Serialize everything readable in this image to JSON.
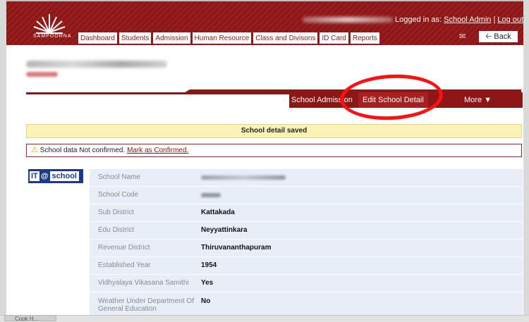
{
  "app": {
    "logo_text": "SAMPOORNA",
    "login_prefix": "Logged in as:",
    "user_role": "School Admin",
    "separator": "|",
    "logout": "Log out",
    "back": "Back",
    "mail_icon": "envelope-icon",
    "back_icon": "arrow-left-icon"
  },
  "nav": {
    "items": [
      "Dashboard",
      "Students",
      "Admission",
      "Human Resource",
      "Class and Divisons",
      "ID Card",
      "Reports"
    ]
  },
  "subnav": {
    "items": [
      "School Admission",
      "Edit School Detail",
      "More ▼"
    ]
  },
  "notices": {
    "saved": "School detail saved",
    "warning_text": "School data Not confirmed.",
    "warning_link": "Mark as Confirmed.",
    "warning_icon": "warning-triangle-icon"
  },
  "it_logo": {
    "it": "IT",
    "at": "@",
    "school": "school"
  },
  "details": [
    {
      "label": "School Name",
      "value": ""
    },
    {
      "label": "School Code",
      "value": ""
    },
    {
      "label": "Sub District",
      "value": "Kattakada"
    },
    {
      "label": "Edu District",
      "value": "Neyyattinkara"
    },
    {
      "label": "Revenue District",
      "value": "Thiruvananthapuram"
    },
    {
      "label": "Established Year",
      "value": "1954"
    },
    {
      "label": "Vidhyalaya Vikasana Samithi",
      "value": "Yes"
    },
    {
      "label": "Weather Under Department Of General Education",
      "value": "No"
    }
  ],
  "taskbar": {
    "item": "Cook H..."
  },
  "colors": {
    "brand": "#8f1616",
    "notice_bg": "#fbf3b6",
    "table_bg": "#e8eef8",
    "annotation": "#ff1010"
  }
}
